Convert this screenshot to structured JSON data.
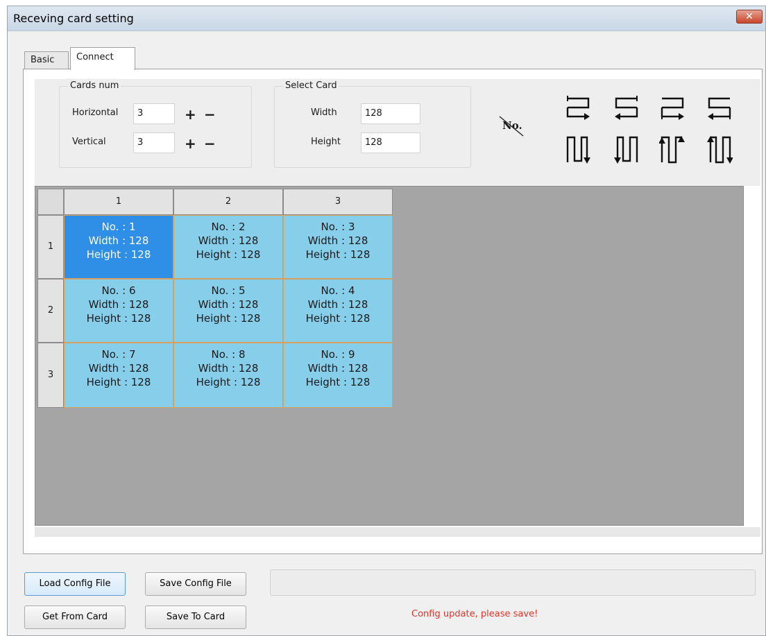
{
  "window": {
    "title": "Receving card setting",
    "close_icon": "close-icon"
  },
  "tabs": [
    {
      "label": "Basic",
      "active": false
    },
    {
      "label": "Connect",
      "active": true
    }
  ],
  "cards_num": {
    "title": "Cards num",
    "horizontal_label": "Horizontal",
    "horizontal_value": "3",
    "vertical_label": "Vertical",
    "vertical_value": "3",
    "plus": "+",
    "minus": "−"
  },
  "select_card": {
    "title": "Select Card",
    "width_label": "Width",
    "width_value": "128",
    "height_label": "Height",
    "height_value": "128"
  },
  "no_toggle": "No.",
  "grid": {
    "col_headers": [
      "1",
      "2",
      "3"
    ],
    "row_headers": [
      "1",
      "2",
      "3"
    ],
    "rows": [
      [
        {
          "no": "No. : 1",
          "width": "Width : 128",
          "height": "Height : 128",
          "selected": true
        },
        {
          "no": "No. : 2",
          "width": "Width : 128",
          "height": "Height : 128"
        },
        {
          "no": "No. : 3",
          "width": "Width : 128",
          "height": "Height : 128"
        }
      ],
      [
        {
          "no": "No. : 6",
          "width": "Width : 128",
          "height": "Height : 128"
        },
        {
          "no": "No. : 5",
          "width": "Width : 128",
          "height": "Height : 128"
        },
        {
          "no": "No. : 4",
          "width": "Width : 128",
          "height": "Height : 128"
        }
      ],
      [
        {
          "no": "No. : 7",
          "width": "Width : 128",
          "height": "Height : 128"
        },
        {
          "no": "No. : 8",
          "width": "Width : 128",
          "height": "Height : 128"
        },
        {
          "no": "No. : 9",
          "width": "Width : 128",
          "height": "Height : 128"
        }
      ]
    ]
  },
  "buttons": {
    "load_config": "Load Config File",
    "save_config": "Save Config File",
    "get_from_card": "Get From Card",
    "save_to_card": "Save To Card"
  },
  "status_text": "Config update, please save!",
  "colors": {
    "cell": "#87ceea",
    "cell_selected": "#2f8ee5",
    "status": "#e0342a"
  }
}
